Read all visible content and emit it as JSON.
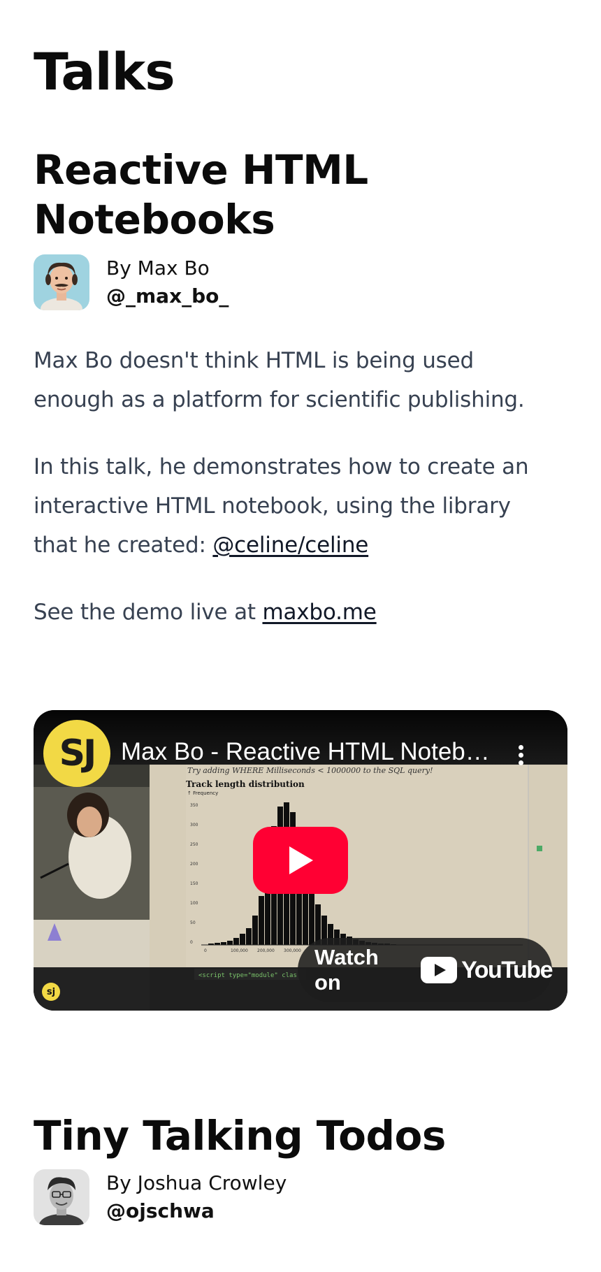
{
  "page": {
    "title": "Talks"
  },
  "talks": [
    {
      "title_line1": "Reactive HTML",
      "title_line2": "Notebooks",
      "author_name": "By Max Bo",
      "author_handle": "@_max_bo_",
      "paragraph1_line1": "Max Bo doesn't think HTML is being used",
      "paragraph1_line2": "enough as a platform for scientific publishing.",
      "paragraph2_line1": "In this talk, he demonstrates how to create an",
      "paragraph2_line2": "interactive HTML notebook, using the library",
      "paragraph2_line3_prefix": "that he created: ",
      "paragraph2_link": "@celine/celine",
      "paragraph3_prefix": "See the demo live at ",
      "paragraph3_link": "maxbo.me",
      "video": {
        "channel_initials": "SJ",
        "title": "Max Bo - Reactive HTML Notebooks",
        "watch_on_label": "Watch on",
        "youtube_word": "YouTube",
        "screen_caption": "Try adding  WHERE Milliseconds < 1000000  to the SQL query!",
        "chart_title": "Track length distribution",
        "chart_ylabel": "↑ Frequency",
        "chart_yticks": [
          "350",
          "300",
          "250",
          "200",
          "150",
          "100",
          "50",
          "0"
        ],
        "chart_xticks": [
          "0",
          "100,000",
          "200,000",
          "300,000"
        ],
        "code_snippet": "<script type=\"module\" clas",
        "corner_badge": "sj"
      }
    },
    {
      "title_line1": "Tiny Talking Todos",
      "author_name": "By Joshua Crowley",
      "author_handle": "@ojschwa"
    }
  ],
  "colors": {
    "heading": "#0b0b0b",
    "body_text": "#374151",
    "youtube_red": "#ff0033",
    "channel_yellow": "#f2d945"
  }
}
